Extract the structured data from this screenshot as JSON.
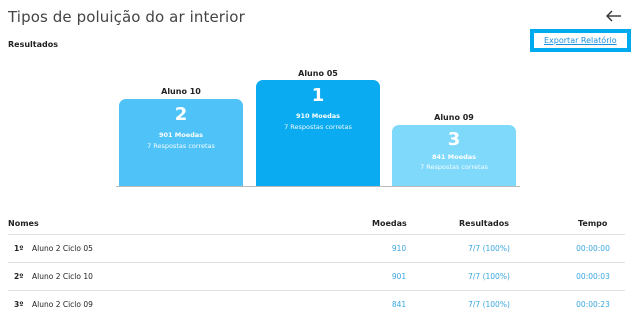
{
  "page": {
    "title": "Tipos de poluição do ar interior",
    "subtitle": "Resultados",
    "export_label": "Exportar Relatório",
    "back_icon": "arrow-left-icon"
  },
  "colors": {
    "first": "#0aabf0",
    "second": "#4fc3f7",
    "third": "#7fd9fb",
    "link": "#1a8fe0",
    "highlight_box": "#00aaee"
  },
  "podium": {
    "first": {
      "name": "Aluno 05",
      "rank": "1",
      "coins": "910 Moedas",
      "correct": "7 Respostas corretas"
    },
    "second": {
      "name": "Aluno 10",
      "rank": "2",
      "coins": "901 Moedas",
      "correct": "7 Respostas corretas"
    },
    "third": {
      "name": "Aluno 09",
      "rank": "3",
      "coins": "841 Moedas",
      "correct": "7 Respostas corretas"
    }
  },
  "table": {
    "headers": {
      "names": "Nomes",
      "coins": "Moedas",
      "results": "Resultados",
      "time": "Tempo"
    },
    "rows": [
      {
        "position": "1º",
        "name": "Aluno 2 Ciclo 05",
        "coins": "910",
        "result": "7/7 (100%)",
        "time": "00:00:00"
      },
      {
        "position": "2º",
        "name": "Aluno 2 Ciclo 10",
        "coins": "901",
        "result": "7/7 (100%)",
        "time": "00:00:03"
      },
      {
        "position": "3º",
        "name": "Aluno 2 Ciclo 09",
        "coins": "841",
        "result": "7/7 (100%)",
        "time": "00:00:23"
      }
    ]
  }
}
